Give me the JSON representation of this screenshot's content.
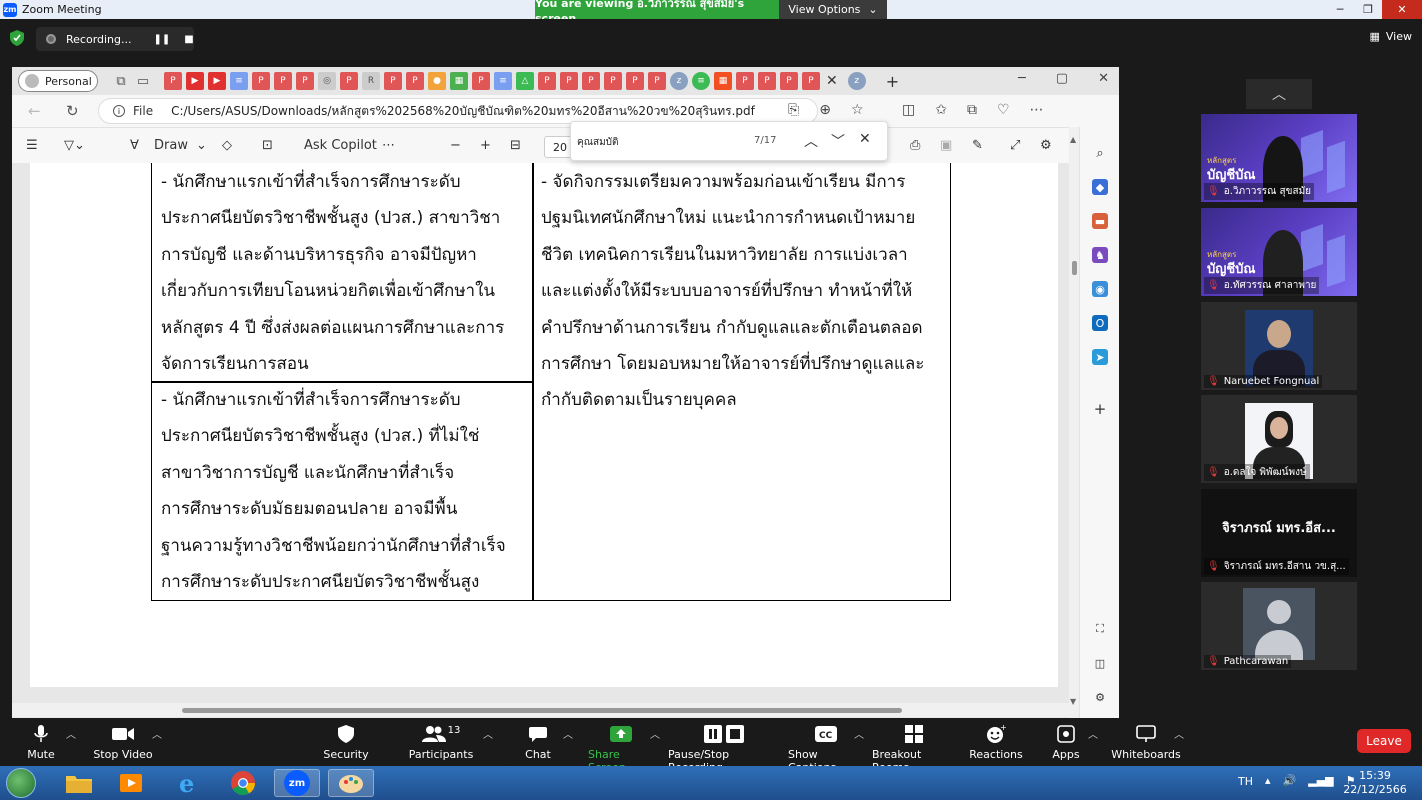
{
  "zoom": {
    "window_title": "Zoom Meeting",
    "viewing_banner": "You are viewing อ.วิภาวรรณ สุขสมัย's screen",
    "view_options_label": "View Options",
    "recording_label": "Recording...",
    "view_label": "View",
    "toolbar": [
      {
        "label": "Mute",
        "icon": "mic-icon"
      },
      {
        "label": "Stop Video",
        "icon": "video-icon"
      },
      {
        "label": "Security",
        "icon": "shield-icon"
      },
      {
        "label": "Participants",
        "icon": "participants-icon",
        "count": "13"
      },
      {
        "label": "Chat",
        "icon": "chat-icon"
      },
      {
        "label": "Share Screen",
        "icon": "share-screen-icon"
      },
      {
        "label": "Pause/Stop Recording",
        "icon": "recording-icon"
      },
      {
        "label": "Show Captions",
        "icon": "captions-icon"
      },
      {
        "label": "Breakout Rooms",
        "icon": "breakout-icon"
      },
      {
        "label": "Reactions",
        "icon": "reactions-icon"
      },
      {
        "label": "Apps",
        "icon": "apps-icon"
      },
      {
        "label": "Whiteboards",
        "icon": "whiteboard-icon"
      }
    ],
    "leave_label": "Leave",
    "participants": [
      {
        "name": "อ.วิภาวรรณ สุขสมัย",
        "type": "slide"
      },
      {
        "name": "อ.ทัศวรรณ ศาลาพาย",
        "type": "slide"
      },
      {
        "name": "Naruebet Fongnual",
        "type": "photo"
      },
      {
        "name": "อ.ดลใจ พิพัฒน์พงษ์",
        "type": "photo"
      },
      {
        "name": "จิราภรณ์ มทร.อีสาน วข.สุ...",
        "type": "text",
        "display": "จิราภรณ์ มทร.อีส..."
      },
      {
        "name": "Pathcarawan",
        "type": "avatar"
      }
    ],
    "slide_tile_title": "บัญชีบัณ",
    "slide_tile_sub": "หลักสูตร"
  },
  "browser": {
    "profile_label": "Personal",
    "url_prefix": "File",
    "url": "C:/Users/ASUS/Downloads/หลักสูตร%202568%20บัญชีบัณฑิต%20มทร%20อีสาน%20วข%20สุรินทร.pdf",
    "draw_label": "Draw",
    "ask_copilot_label": "Ask Copilot",
    "page_number": "20",
    "find_query": "คุณสมบัติ",
    "find_count": "7/17"
  },
  "pdf": {
    "cell_a": [
      "- นักศึกษาแรกเข้าที่สำเร็จการศึกษาระดับ",
      "ประกาศนียบัตรวิชาชีพชั้นสูง (ปวส.) สาขาวิชา",
      "การบัญชี และด้านบริหารธุรกิจ อาจมีปัญหา",
      "เกี่ยวกับการเทียบโอนหน่วยกิตเพื่อเข้าศึกษาใน",
      "หลักสูตร 4 ปี ซึ่งส่งผลต่อแผนการศึกษาและการ",
      "จัดการเรียนการสอน"
    ],
    "cell_b": [
      "- นักศึกษาแรกเข้าที่สำเร็จการศึกษาระดับ",
      "ประกาศนียบัตรวิชาชีพชั้นสูง (ปวส.) ที่ไม่ใช่",
      "สาขาวิชาการบัญชี และนักศึกษาที่สำเร็จ",
      "การศึกษาระดับมัธยมตอนปลาย อาจมีพื้น",
      "ฐานความรู้ทางวิชาชีพน้อยกว่านักศึกษาที่สำเร็จ",
      "การศึกษาระดับประกาศนียบัตรวิชาชีพชั้นสูง"
    ],
    "cell_c": [
      "- จัดกิจกรรมเตรียมความพร้อมก่อนเข้าเรียน มีการ",
      "ปฐมนิเทศนักศึกษาใหม่ แนะนำการกำหนดเป้าหมาย",
      "ชีวิต เทคนิคการเรียนในมหาวิทยาลัย การแบ่งเวลา",
      "และแต่งตั้งให้มีระบบบอาจารย์ที่ปรึกษา ทำหน้าที่ให้",
      "คำปรึกษาด้านการเรียน กำกับดูแลและตักเตือนตลอด",
      "การศึกษา โดยมอบหมายให้อาจารย์ที่ปรึกษาดูแลและ",
      "กำกับติดตามเป็นรายบุคคล"
    ]
  },
  "taskbar": {
    "language": "TH",
    "time": "15:39",
    "date": "22/12/2566",
    "zoom_icon_label": "zm"
  }
}
